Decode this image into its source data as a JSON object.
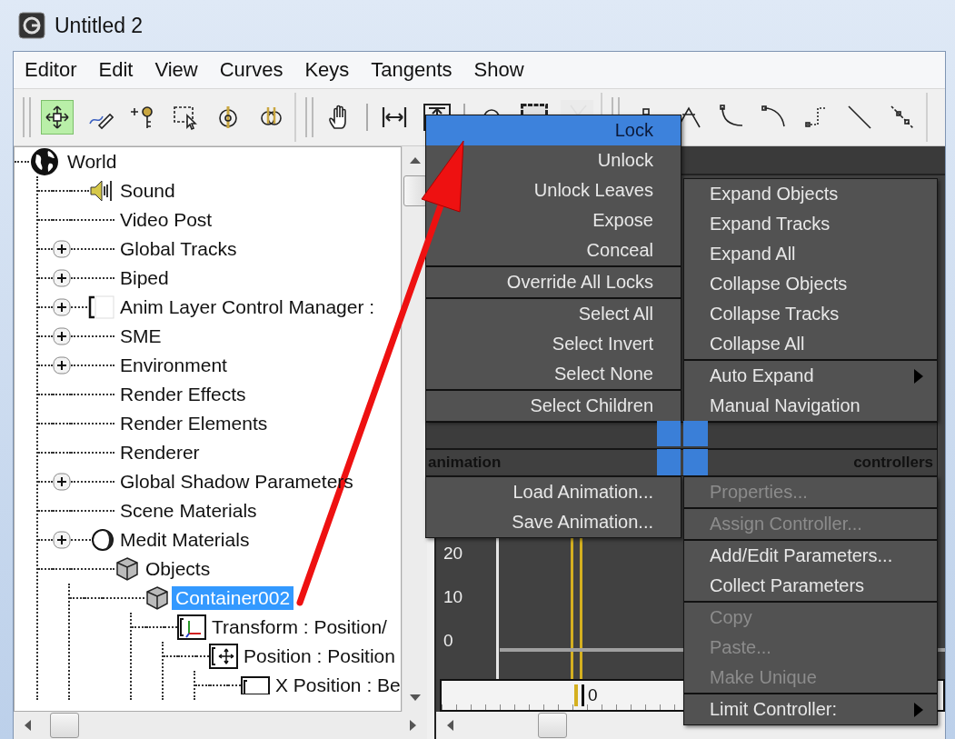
{
  "window": {
    "title": "Untitled 2"
  },
  "menu_bar": [
    "Editor",
    "Edit",
    "View",
    "Curves",
    "Keys",
    "Tangents",
    "Show"
  ],
  "toolbar": {
    "groups": [
      [
        [
          {
            "kind": "move-keys",
            "selected": true,
            "disabled": false
          },
          {
            "kind": "draw-curves",
            "selected": false,
            "disabled": false
          },
          {
            "kind": "add-keys",
            "selected": false,
            "disabled": false
          },
          {
            "kind": "region-select",
            "selected": false,
            "disabled": false
          },
          {
            "kind": "slide-keys",
            "selected": false,
            "disabled": false
          },
          {
            "kind": "scale-keys",
            "selected": false,
            "disabled": false
          }
        ]
      ],
      [
        [
          {
            "kind": "pan",
            "selected": false,
            "disabled": false
          }
        ],
        [
          {
            "kind": "fit-horizontal",
            "selected": false,
            "disabled": false
          },
          {
            "kind": "fit-vertical",
            "selected": false,
            "disabled": false
          }
        ],
        [
          {
            "kind": "zoom",
            "selected": false,
            "disabled": false
          },
          {
            "kind": "zoom-region",
            "selected": false,
            "disabled": false
          },
          {
            "kind": "cut",
            "selected": false,
            "disabled": true
          }
        ]
      ],
      [
        [
          {
            "kind": "tangent-custom",
            "selected": false,
            "disabled": false
          },
          {
            "kind": "tangent-auto",
            "selected": false,
            "disabled": false
          },
          {
            "kind": "tangent-smooth",
            "selected": false,
            "disabled": false
          },
          {
            "kind": "tangent-slow",
            "selected": false,
            "disabled": false
          },
          {
            "kind": "tangent-step",
            "selected": false,
            "disabled": false
          },
          {
            "kind": "tangent-linear",
            "selected": false,
            "disabled": false
          },
          {
            "kind": "tangent-fast",
            "selected": false,
            "disabled": false
          }
        ]
      ]
    ]
  },
  "tree": [
    {
      "label": "World",
      "kind": "globe",
      "collapsed": false,
      "selected": false,
      "children": [
        {
          "label": "Sound",
          "kind": "sound",
          "collapsed": false,
          "selected": false
        },
        {
          "label": "Video Post",
          "kind": "track",
          "collapsed": false,
          "selected": false
        },
        {
          "label": "Global Tracks",
          "kind": "track",
          "collapsed": true,
          "selected": false
        },
        {
          "label": "Biped",
          "kind": "track",
          "collapsed": true,
          "selected": false
        },
        {
          "label": "Anim Layer Control Manager :",
          "kind": "layer",
          "collapsed": true,
          "selected": false
        },
        {
          "label": "SME",
          "kind": "track",
          "collapsed": true,
          "selected": false
        },
        {
          "label": "Environment",
          "kind": "track",
          "collapsed": true,
          "selected": false
        },
        {
          "label": "Render Effects",
          "kind": "track",
          "collapsed": false,
          "selected": false
        },
        {
          "label": "Render Elements",
          "kind": "track",
          "collapsed": false,
          "selected": false
        },
        {
          "label": "Renderer",
          "kind": "track",
          "collapsed": false,
          "selected": false
        },
        {
          "label": "Global Shadow Parameters",
          "kind": "track",
          "collapsed": true,
          "selected": false
        },
        {
          "label": "Scene Materials",
          "kind": "track",
          "collapsed": false,
          "selected": false
        },
        {
          "label": "Medit Materials",
          "kind": "material",
          "collapsed": true,
          "selected": false
        },
        {
          "label": "Objects",
          "kind": "cube",
          "collapsed": false,
          "selected": false,
          "children": [
            {
              "label": "Container002",
              "kind": "cube",
              "collapsed": false,
              "selected": true,
              "children": [
                {
                  "label": "Transform : Position/",
                  "kind": "transform",
                  "collapsed": false,
                  "selected": false,
                  "children": [
                    {
                      "label": "Position : Position",
                      "kind": "position",
                      "collapsed": false,
                      "selected": false,
                      "children": [
                        {
                          "label": "X Position : Be",
                          "kind": "controller",
                          "collapsed": false,
                          "selected": false
                        }
                      ]
                    }
                  ]
                }
              ]
            }
          ]
        }
      ]
    }
  ],
  "graph": {
    "y_labels": [
      "20",
      "10",
      "0"
    ],
    "ruler_label": "0"
  },
  "quad_menu": {
    "quadrants": [
      {
        "groups": [
          [
            {
              "label": "Lock",
              "selected": true,
              "disabled": false,
              "submenu": false
            },
            {
              "label": "Unlock",
              "selected": false,
              "disabled": false,
              "submenu": false
            },
            {
              "label": "Unlock Leaves",
              "selected": false,
              "disabled": false,
              "submenu": false
            },
            {
              "label": "Expose",
              "selected": false,
              "disabled": false,
              "submenu": false
            },
            {
              "label": "Conceal",
              "selected": false,
              "disabled": false,
              "submenu": false
            }
          ],
          [
            {
              "label": "Override All Locks",
              "selected": false,
              "disabled": false,
              "submenu": false
            }
          ],
          [
            {
              "label": "Select All",
              "selected": false,
              "disabled": false,
              "submenu": false
            },
            {
              "label": "Select Invert",
              "selected": false,
              "disabled": false,
              "submenu": false
            },
            {
              "label": "Select None",
              "selected": false,
              "disabled": false,
              "submenu": false
            }
          ],
          [
            {
              "label": "Select Children",
              "selected": false,
              "disabled": false,
              "submenu": false
            }
          ]
        ]
      },
      {
        "groups": [
          [
            {
              "label": "Expand Objects",
              "selected": false,
              "disabled": false,
              "submenu": false
            },
            {
              "label": "Expand Tracks",
              "selected": false,
              "disabled": false,
              "submenu": false
            },
            {
              "label": "Expand All",
              "selected": false,
              "disabled": false,
              "submenu": false
            },
            {
              "label": "Collapse Objects",
              "selected": false,
              "disabled": false,
              "submenu": false
            },
            {
              "label": "Collapse Tracks",
              "selected": false,
              "disabled": false,
              "submenu": false
            },
            {
              "label": "Collapse All",
              "selected": false,
              "disabled": false,
              "submenu": false
            }
          ],
          [
            {
              "label": "Auto Expand",
              "selected": false,
              "disabled": false,
              "submenu": true
            },
            {
              "label": "Manual Navigation",
              "selected": false,
              "disabled": false,
              "submenu": false
            }
          ]
        ]
      },
      {
        "title": "animation",
        "groups": [
          [
            {
              "label": "Load Animation...",
              "selected": false,
              "disabled": false,
              "submenu": false
            },
            {
              "label": "Save Animation...",
              "selected": false,
              "disabled": false,
              "submenu": false
            }
          ]
        ]
      },
      {
        "title": "controllers",
        "groups": [
          [
            {
              "label": "Properties...",
              "selected": false,
              "disabled": true,
              "submenu": false
            }
          ],
          [
            {
              "label": "Assign Controller...",
              "selected": false,
              "disabled": true,
              "submenu": false
            }
          ],
          [
            {
              "label": "Add/Edit Parameters...",
              "selected": false,
              "disabled": false,
              "submenu": false
            },
            {
              "label": "Collect Parameters",
              "selected": false,
              "disabled": false,
              "submenu": false
            }
          ],
          [
            {
              "label": "Copy",
              "selected": false,
              "disabled": true,
              "submenu": false
            },
            {
              "label": "Paste...",
              "selected": false,
              "disabled": true,
              "submenu": false
            },
            {
              "label": "Make Unique",
              "selected": false,
              "disabled": true,
              "submenu": false
            }
          ],
          [
            {
              "label": "Limit Controller:",
              "selected": false,
              "disabled": false,
              "submenu": true
            }
          ]
        ]
      }
    ]
  }
}
